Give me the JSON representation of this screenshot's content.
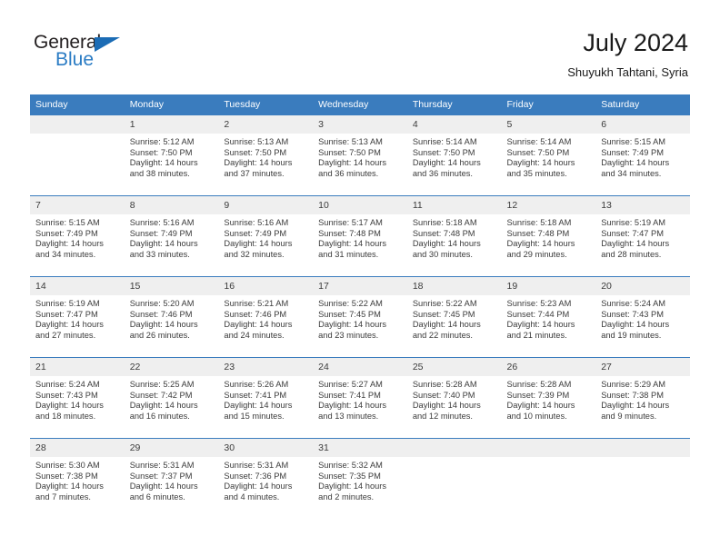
{
  "brand": {
    "name_primary": "General",
    "name_secondary": "Blue",
    "flag_icon": "blue-triangle-flag-icon"
  },
  "header": {
    "title": "July 2024",
    "subtitle": "Shuyukh Tahtani, Syria"
  },
  "colors": {
    "header_blue": "#3a7cbe",
    "brand_blue": "#2b7cc4",
    "flag_blue": "#1b6cb5",
    "daynum_band": "#efefef",
    "text": "#3b3b3b"
  },
  "weekday_headers": [
    "Sunday",
    "Monday",
    "Tuesday",
    "Wednesday",
    "Thursday",
    "Friday",
    "Saturday"
  ],
  "weeks": [
    [
      {
        "day": "",
        "lines": []
      },
      {
        "day": "1",
        "lines": [
          "Sunrise: 5:12 AM",
          "Sunset: 7:50 PM",
          "Daylight: 14 hours",
          "and 38 minutes."
        ]
      },
      {
        "day": "2",
        "lines": [
          "Sunrise: 5:13 AM",
          "Sunset: 7:50 PM",
          "Daylight: 14 hours",
          "and 37 minutes."
        ]
      },
      {
        "day": "3",
        "lines": [
          "Sunrise: 5:13 AM",
          "Sunset: 7:50 PM",
          "Daylight: 14 hours",
          "and 36 minutes."
        ]
      },
      {
        "day": "4",
        "lines": [
          "Sunrise: 5:14 AM",
          "Sunset: 7:50 PM",
          "Daylight: 14 hours",
          "and 36 minutes."
        ]
      },
      {
        "day": "5",
        "lines": [
          "Sunrise: 5:14 AM",
          "Sunset: 7:50 PM",
          "Daylight: 14 hours",
          "and 35 minutes."
        ]
      },
      {
        "day": "6",
        "lines": [
          "Sunrise: 5:15 AM",
          "Sunset: 7:49 PM",
          "Daylight: 14 hours",
          "and 34 minutes."
        ]
      }
    ],
    [
      {
        "day": "7",
        "lines": [
          "Sunrise: 5:15 AM",
          "Sunset: 7:49 PM",
          "Daylight: 14 hours",
          "and 34 minutes."
        ]
      },
      {
        "day": "8",
        "lines": [
          "Sunrise: 5:16 AM",
          "Sunset: 7:49 PM",
          "Daylight: 14 hours",
          "and 33 minutes."
        ]
      },
      {
        "day": "9",
        "lines": [
          "Sunrise: 5:16 AM",
          "Sunset: 7:49 PM",
          "Daylight: 14 hours",
          "and 32 minutes."
        ]
      },
      {
        "day": "10",
        "lines": [
          "Sunrise: 5:17 AM",
          "Sunset: 7:48 PM",
          "Daylight: 14 hours",
          "and 31 minutes."
        ]
      },
      {
        "day": "11",
        "lines": [
          "Sunrise: 5:18 AM",
          "Sunset: 7:48 PM",
          "Daylight: 14 hours",
          "and 30 minutes."
        ]
      },
      {
        "day": "12",
        "lines": [
          "Sunrise: 5:18 AM",
          "Sunset: 7:48 PM",
          "Daylight: 14 hours",
          "and 29 minutes."
        ]
      },
      {
        "day": "13",
        "lines": [
          "Sunrise: 5:19 AM",
          "Sunset: 7:47 PM",
          "Daylight: 14 hours",
          "and 28 minutes."
        ]
      }
    ],
    [
      {
        "day": "14",
        "lines": [
          "Sunrise: 5:19 AM",
          "Sunset: 7:47 PM",
          "Daylight: 14 hours",
          "and 27 minutes."
        ]
      },
      {
        "day": "15",
        "lines": [
          "Sunrise: 5:20 AM",
          "Sunset: 7:46 PM",
          "Daylight: 14 hours",
          "and 26 minutes."
        ]
      },
      {
        "day": "16",
        "lines": [
          "Sunrise: 5:21 AM",
          "Sunset: 7:46 PM",
          "Daylight: 14 hours",
          "and 24 minutes."
        ]
      },
      {
        "day": "17",
        "lines": [
          "Sunrise: 5:22 AM",
          "Sunset: 7:45 PM",
          "Daylight: 14 hours",
          "and 23 minutes."
        ]
      },
      {
        "day": "18",
        "lines": [
          "Sunrise: 5:22 AM",
          "Sunset: 7:45 PM",
          "Daylight: 14 hours",
          "and 22 minutes."
        ]
      },
      {
        "day": "19",
        "lines": [
          "Sunrise: 5:23 AM",
          "Sunset: 7:44 PM",
          "Daylight: 14 hours",
          "and 21 minutes."
        ]
      },
      {
        "day": "20",
        "lines": [
          "Sunrise: 5:24 AM",
          "Sunset: 7:43 PM",
          "Daylight: 14 hours",
          "and 19 minutes."
        ]
      }
    ],
    [
      {
        "day": "21",
        "lines": [
          "Sunrise: 5:24 AM",
          "Sunset: 7:43 PM",
          "Daylight: 14 hours",
          "and 18 minutes."
        ]
      },
      {
        "day": "22",
        "lines": [
          "Sunrise: 5:25 AM",
          "Sunset: 7:42 PM",
          "Daylight: 14 hours",
          "and 16 minutes."
        ]
      },
      {
        "day": "23",
        "lines": [
          "Sunrise: 5:26 AM",
          "Sunset: 7:41 PM",
          "Daylight: 14 hours",
          "and 15 minutes."
        ]
      },
      {
        "day": "24",
        "lines": [
          "Sunrise: 5:27 AM",
          "Sunset: 7:41 PM",
          "Daylight: 14 hours",
          "and 13 minutes."
        ]
      },
      {
        "day": "25",
        "lines": [
          "Sunrise: 5:28 AM",
          "Sunset: 7:40 PM",
          "Daylight: 14 hours",
          "and 12 minutes."
        ]
      },
      {
        "day": "26",
        "lines": [
          "Sunrise: 5:28 AM",
          "Sunset: 7:39 PM",
          "Daylight: 14 hours",
          "and 10 minutes."
        ]
      },
      {
        "day": "27",
        "lines": [
          "Sunrise: 5:29 AM",
          "Sunset: 7:38 PM",
          "Daylight: 14 hours",
          "and 9 minutes."
        ]
      }
    ],
    [
      {
        "day": "28",
        "lines": [
          "Sunrise: 5:30 AM",
          "Sunset: 7:38 PM",
          "Daylight: 14 hours",
          "and 7 minutes."
        ]
      },
      {
        "day": "29",
        "lines": [
          "Sunrise: 5:31 AM",
          "Sunset: 7:37 PM",
          "Daylight: 14 hours",
          "and 6 minutes."
        ]
      },
      {
        "day": "30",
        "lines": [
          "Sunrise: 5:31 AM",
          "Sunset: 7:36 PM",
          "Daylight: 14 hours",
          "and 4 minutes."
        ]
      },
      {
        "day": "31",
        "lines": [
          "Sunrise: 5:32 AM",
          "Sunset: 7:35 PM",
          "Daylight: 14 hours",
          "and 2 minutes."
        ]
      },
      {
        "day": "",
        "lines": []
      },
      {
        "day": "",
        "lines": []
      },
      {
        "day": "",
        "lines": []
      }
    ]
  ]
}
